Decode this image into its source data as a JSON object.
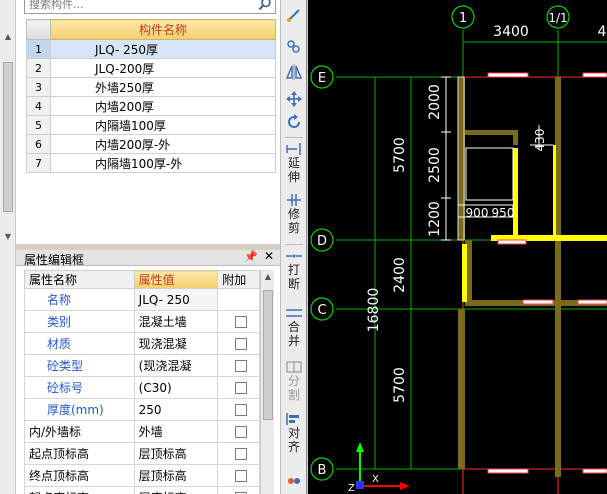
{
  "search": {
    "placeholder": "搜索构件..."
  },
  "component_table": {
    "header": "构件名称",
    "selected_index": 0,
    "rows": [
      {
        "num": "1",
        "name": "JLQ- 250厚"
      },
      {
        "num": "2",
        "name": "JLQ-200厚"
      },
      {
        "num": "3",
        "name": "外墙250厚"
      },
      {
        "num": "4",
        "name": "内墙200厚"
      },
      {
        "num": "5",
        "name": "内隔墙100厚"
      },
      {
        "num": "6",
        "name": "内墙200厚-外"
      },
      {
        "num": "7",
        "name": "内隔墙100厚-外"
      }
    ]
  },
  "property_panel": {
    "title": "属性编辑框",
    "pin_icon": "pin-icon",
    "close_icon": "close-icon",
    "headers": {
      "name": "属性名称",
      "value": "属性值",
      "extra": "附加"
    },
    "rows": [
      {
        "name": "名称",
        "value": "JLQ- 250",
        "checkbox": false
      },
      {
        "name": "类别",
        "value": "混凝土墙",
        "checkbox": true
      },
      {
        "name": "材质",
        "value": "现浇混凝",
        "checkbox": true
      },
      {
        "name": "砼类型",
        "value": "(现浇混凝",
        "checkbox": true
      },
      {
        "name": "砼标号",
        "value": "(C30)",
        "checkbox": true
      },
      {
        "name": "厚度(mm)",
        "value": "250",
        "checkbox": true
      },
      {
        "name": "内/外墙标",
        "value": "外墙",
        "checkbox": true
      },
      {
        "name": "起点顶标高",
        "value": "层顶标高",
        "checkbox": true
      },
      {
        "name": "终点顶标高",
        "value": "层顶标高",
        "checkbox": true
      },
      {
        "name": "起点底标高",
        "value": "层底标高",
        "checkbox": true
      }
    ]
  },
  "toolbar": {
    "buttons": [
      {
        "icon": "brush-icon"
      },
      {
        "icon": "copy-icon"
      },
      {
        "icon": "mirror-icon"
      },
      {
        "icon": "move-icon"
      },
      {
        "icon": "rotate-icon"
      },
      {
        "icon": "extend-icon",
        "label": "延伸"
      },
      {
        "icon": "trim-icon",
        "label": "修剪"
      },
      {
        "icon": "break-icon",
        "label": "打断"
      },
      {
        "icon": "merge-icon",
        "label": "合并"
      },
      {
        "icon": "split-icon",
        "label": "分割"
      },
      {
        "icon": "align-icon",
        "label": "对齐"
      },
      {
        "icon": "offset-icon"
      }
    ]
  },
  "drawing": {
    "axis_labels": [
      "1",
      "1/1",
      "E",
      "D",
      "C",
      "B"
    ],
    "dimensions": [
      "3400",
      "2000",
      "5700",
      "2500",
      "1200",
      "900",
      "950",
      "430",
      "2400",
      "16800",
      "5700"
    ],
    "colors": {
      "wall": "#7a6a1c",
      "wall_highlight": "#ffff00",
      "axis_green": "#00d000",
      "dim_white": "#ffffff",
      "window_red": "#ff2020",
      "axis_red": "#ff0000"
    }
  }
}
